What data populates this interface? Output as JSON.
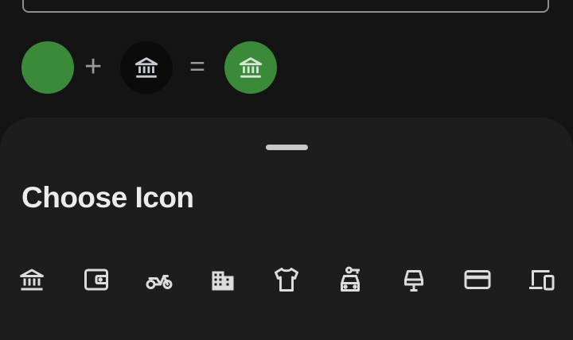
{
  "preview": {
    "color": "#3a8a3a",
    "plus_symbol": "+",
    "equals_symbol": "=",
    "selected_icon": "bank-icon",
    "icon_color": "#c8cad3"
  },
  "sheet": {
    "title": "Choose Icon",
    "icons": [
      "bank-icon",
      "wallet-icon",
      "scooter-icon",
      "buildings-icon",
      "tshirt-icon",
      "car-key-icon",
      "parking-icon",
      "credit-card-icon",
      "devices-icon"
    ]
  }
}
